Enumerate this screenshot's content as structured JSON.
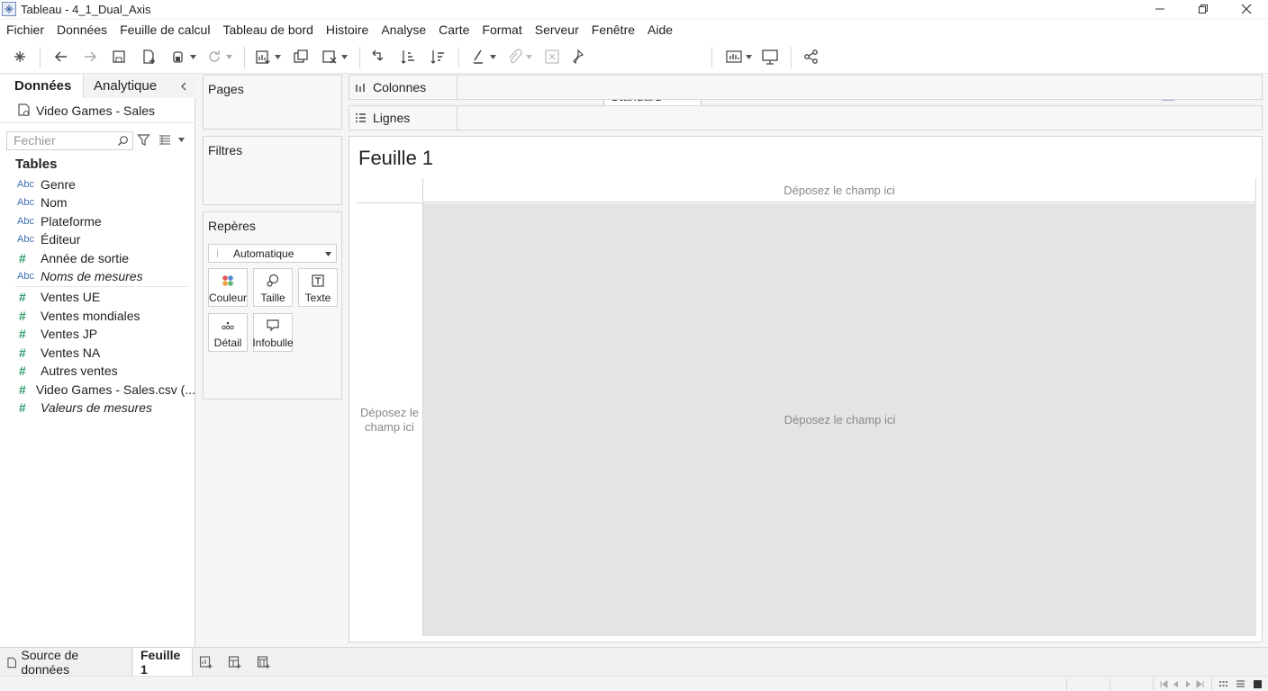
{
  "window": {
    "title": "Tableau - 4_1_Dual_Axis"
  },
  "menu": [
    "Fichier",
    "Données",
    "Feuille de calcul",
    "Tableau de bord",
    "Histoire",
    "Analyse",
    "Carte",
    "Format",
    "Serveur",
    "Fenêtre",
    "Aide"
  ],
  "toolbar": {
    "fit_select": "Standard",
    "show_me": "Montre-moi"
  },
  "data_pane": {
    "tab_data": "Données",
    "tab_analytics": "Analytique",
    "datasource": "Video Games - Sales",
    "search_placeholder": "Fechier",
    "tables_heading": "Tables",
    "dimensions": [
      {
        "type": "Abc",
        "name": "Genre"
      },
      {
        "type": "Abc",
        "name": "Nom"
      },
      {
        "type": "Abc",
        "name": "Plateforme"
      },
      {
        "type": "Abc",
        "name": "Éditeur"
      },
      {
        "type": "#",
        "name": "Année de sortie"
      },
      {
        "type": "Abc",
        "name": "Noms de mesures"
      }
    ],
    "measures": [
      {
        "type": "#",
        "name": "Ventes UE"
      },
      {
        "type": "#",
        "name": "Ventes mondiales"
      },
      {
        "type": "#",
        "name": "Ventes JP"
      },
      {
        "type": "#",
        "name": "Ventes NA"
      },
      {
        "type": "#",
        "name": "Autres ventes"
      },
      {
        "type": "#",
        "name": "Video Games - Sales.csv (..."
      },
      {
        "type": "#",
        "name": "Valeurs de mesures"
      }
    ]
  },
  "cards": {
    "pages": "Pages",
    "filters": "Filtres",
    "marks": "Repères",
    "mark_type": "Automatique",
    "buttons": {
      "color": "Couleur",
      "size": "Taille",
      "text": "Texte",
      "detail": "Détail",
      "tooltip": "Infobulle"
    }
  },
  "shelves": {
    "columns": "Colonnes",
    "rows": "Lignes"
  },
  "canvas": {
    "sheet_title": "Feuille 1",
    "drop_top": "Déposez le champ ici",
    "drop_left": "Déposez le champ ici",
    "drop_main": "Déposez le champ ici"
  },
  "bottom_tabs": {
    "source": "Source de données",
    "sheet": "Feuille 1"
  },
  "colors": {
    "dimension_type": "#3c6fb0",
    "measure_type": "#2f9b6b",
    "drop_area": "#e4e4e4"
  }
}
